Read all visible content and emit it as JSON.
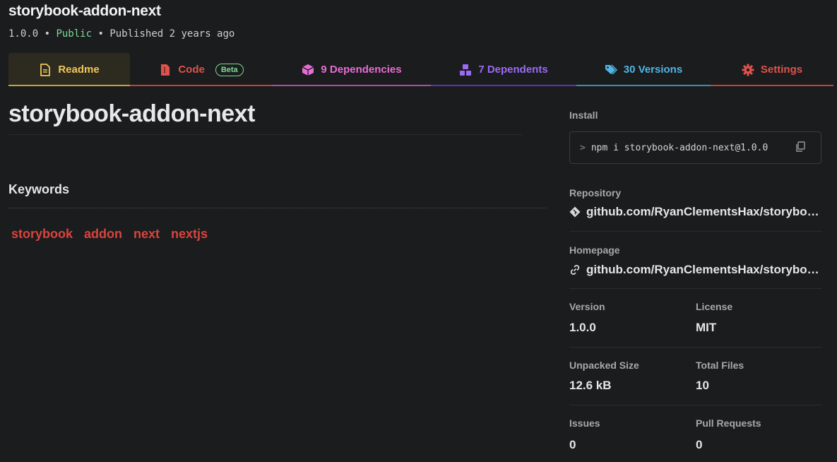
{
  "header": {
    "title": "storybook-addon-next",
    "version": "1.0.0",
    "sep1": " • ",
    "visibility": "Public",
    "sep2": " • ",
    "published": "Published 2 years ago"
  },
  "tabs": {
    "readme": "Readme",
    "code": "Code",
    "code_badge": "Beta",
    "dependencies": "9 Dependencies",
    "dependents": "7 Dependents",
    "versions": "30 Versions",
    "settings": "Settings"
  },
  "readme": {
    "title": "storybook-addon-next",
    "keywords_heading": "Keywords",
    "keywords": [
      "storybook",
      "addon",
      "next",
      "nextjs"
    ]
  },
  "sidebar": {
    "install_label": "Install",
    "install_prompt": ">",
    "install_cmd": "npm i storybook-addon-next@1.0.0",
    "repository_label": "Repository",
    "repository_value": "github.com/RyanClementsHax/storybo…",
    "homepage_label": "Homepage",
    "homepage_value": "github.com/RyanClementsHax/storybo…",
    "version_label": "Version",
    "version_value": "1.0.0",
    "license_label": "License",
    "license_value": "MIT",
    "unpacked_label": "Unpacked Size",
    "unpacked_value": "12.6 kB",
    "files_label": "Total Files",
    "files_value": "10",
    "issues_label": "Issues",
    "issues_value": "0",
    "prs_label": "Pull Requests",
    "prs_value": "0"
  },
  "colors": {
    "public": "#7ddc9a",
    "readme_tab": "#f0c75a",
    "code_tab": "#e0524b",
    "deps_tab": "#e86cd7",
    "dependents_tab": "#9b6bf5",
    "versions_tab": "#4fb6e6",
    "settings_tab": "#e0524b",
    "keyword": "#d9443e"
  }
}
